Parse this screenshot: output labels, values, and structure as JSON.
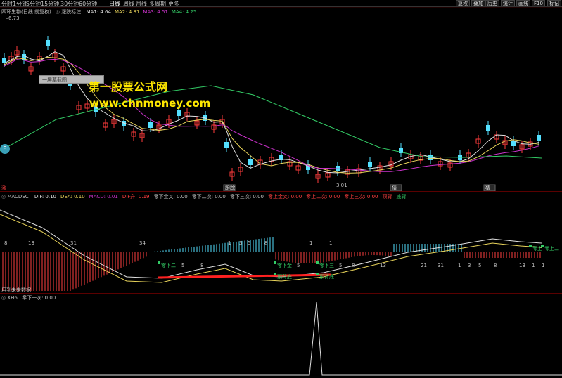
{
  "toolbar": {
    "timeframes": [
      {
        "label": "分时"
      },
      {
        "label": "1分钟"
      },
      {
        "label": "5分钟"
      },
      {
        "label": "15分钟"
      },
      {
        "label": "30分钟"
      },
      {
        "label": "60分钟"
      },
      {
        "label": "日线"
      },
      {
        "label": "周线"
      },
      {
        "label": "月线"
      },
      {
        "label": "多周期"
      },
      {
        "label": "更多"
      }
    ],
    "right_buttons": [
      {
        "label": "复权"
      },
      {
        "label": "叠加"
      },
      {
        "label": "历史"
      },
      {
        "label": "统计"
      },
      {
        "label": "画线"
      },
      {
        "label": "F10"
      },
      {
        "label": "标记"
      }
    ]
  },
  "main_pane": {
    "stock_title": "四环生物(日线 前复权)",
    "indicator_name": "涨跌标注",
    "ma": [
      {
        "label": "MA1: 4.64",
        "color": "#e0e0e0"
      },
      {
        "label": "MA2: 4.81",
        "color": "#e8d35a"
      },
      {
        "label": "MA3: 4.51",
        "color": "#cc33cc"
      },
      {
        "label": "MA4: 4.25",
        "color": "#33cc66"
      }
    ],
    "high_label": "6.73",
    "low_label": "3.01",
    "tooltip": "一屏幕截图",
    "side_badge": "8",
    "marker_bottom_left": "涨",
    "markers": [
      {
        "label": "跟踪"
      },
      {
        "label": "猜"
      },
      {
        "label": "猜"
      }
    ]
  },
  "watermark": {
    "line1": "第一股票公式网",
    "line2": "www.chnmoney.com"
  },
  "macd_pane": {
    "title": "MACDSC",
    "values": [
      {
        "label": "DIF: 0.10",
        "color": "#e0e0e0"
      },
      {
        "label": "DEA: 0.10",
        "color": "#e8d35a"
      },
      {
        "label": "MACD: 0.01",
        "color": "#cc33cc"
      },
      {
        "label": "DIF升: 0.19",
        "color": "#ff4040"
      },
      {
        "label": "零下金叉: 0.00",
        "color": "#c0c0c0"
      },
      {
        "label": "零下二次: 0.00",
        "color": "#c0c0c0"
      },
      {
        "label": "零下三次: 0.00",
        "color": "#c0c0c0"
      },
      {
        "label": "零上金叉: 0.00",
        "color": "#ff4040"
      },
      {
        "label": "零上二次: 0.00",
        "color": "#ff4040"
      },
      {
        "label": "零上三次: 0.00",
        "color": "#ff4040"
      },
      {
        "label": "顶背",
        "color": "#ff4040"
      },
      {
        "label": "底背",
        "color": "#33cc66"
      }
    ],
    "bottom_note": "用到未来数据",
    "counts_top": [
      "8",
      "13",
      "31",
      "34",
      "1",
      "3",
      "5",
      "8",
      "1",
      "1"
    ],
    "counts_mid": [
      "5",
      "8",
      "5",
      "5",
      "8",
      "13",
      "21",
      "31",
      "1",
      "3",
      "5",
      "8",
      "13",
      "1",
      "1"
    ],
    "flags": [
      {
        "label": "零下二"
      },
      {
        "label": "零下金"
      },
      {
        "label": "零下三"
      },
      {
        "label": "顶背底"
      },
      {
        "label": "顶背底"
      },
      {
        "label": "零上"
      },
      {
        "label": "零上二"
      }
    ]
  },
  "xh_pane": {
    "title": "XH6",
    "value_label": "零下一次: 0.00"
  }
}
